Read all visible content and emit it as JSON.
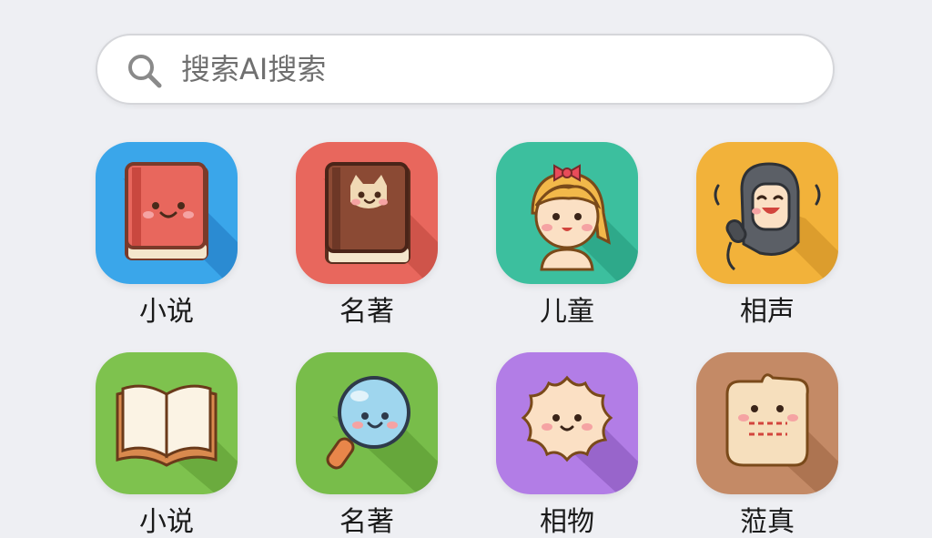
{
  "search": {
    "placeholder": "搜索AI搜索"
  },
  "colors": {
    "background": "#eeeff3",
    "tile_blue": "#3aa6ea",
    "tile_red": "#e8675d",
    "tile_teal": "#3cbf9e",
    "tile_yellow": "#f2b23a",
    "tile_green": "#7ec24e",
    "tile_green2": "#78bd4a",
    "tile_purple": "#b27de6",
    "tile_brown": "#c48a66"
  },
  "grid": {
    "items": [
      {
        "label": "小说",
        "icon": "red-book-icon"
      },
      {
        "label": "名著",
        "icon": "brown-book-cat-icon"
      },
      {
        "label": "儿童",
        "icon": "girl-face-icon"
      },
      {
        "label": "相声",
        "icon": "microphone-performer-icon"
      },
      {
        "label": "小说",
        "icon": "open-book-icon"
      },
      {
        "label": "名著",
        "icon": "magnifier-face-icon"
      },
      {
        "label": "相物",
        "icon": "cookie-face-icon"
      },
      {
        "label": "蒞真",
        "icon": "paper-note-face-icon"
      }
    ]
  }
}
